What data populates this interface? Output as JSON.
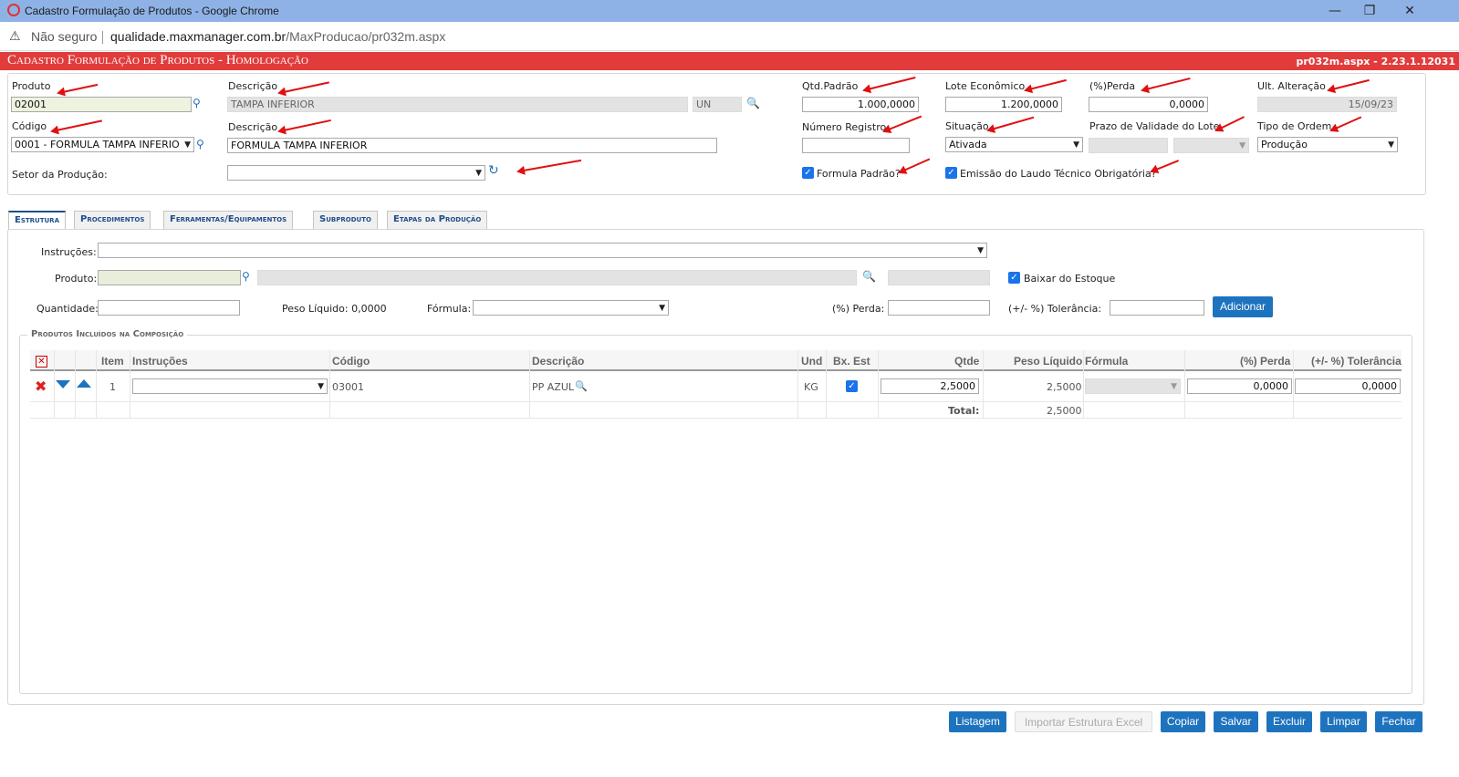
{
  "window": {
    "title": "Cadastro Formulação de Produtos - Google Chrome",
    "security": "Não seguro",
    "url_host": "qualidade.maxmanager.com.br",
    "url_path": "/MaxProducao/pr032m.aspx"
  },
  "header": {
    "title": "Cadastro Formulação de Produtos  - Homologação",
    "version": "pr032m.aspx - 2.23.1.12031",
    "color": "#e23b3b"
  },
  "form": {
    "produto_label": "Produto",
    "produto_value": "02001",
    "descricao_label": "Descrição",
    "descricao_value": "TAMPA INFERIOR",
    "unidade_value": "UN",
    "codigo_label": "Código",
    "codigo_value": "0001 - FORMULA TAMPA INFERIOR",
    "descricao2_label": "Descrição",
    "descricao2_value": "FORMULA TAMPA INFERIOR",
    "setor_label": "Setor da Produção:",
    "setor_value": "",
    "qtd_padrao_label": "Qtd.Padrão",
    "qtd_padrao_value": "1.000,0000",
    "lote_label": "Lote Econômico",
    "lote_value": "1.200,0000",
    "perda_label": "(%)Perda",
    "perda_value": "0,0000",
    "ult_alt_label": "Ult. Alteração",
    "ult_alt_value": "15/09/23",
    "num_registro_label": "Número Registro",
    "num_registro_value": "",
    "situacao_label": "Situação",
    "situacao_value": "Ativada",
    "prazo_label": "Prazo de Validade do Lote",
    "tipo_ordem_label": "Tipo de Ordem",
    "tipo_ordem_value": "Produção",
    "formula_padrao_label": "Formula Padrão?",
    "emissao_laudo_label": "Emissão do Laudo Técnico Obrigatória?"
  },
  "tabs": [
    {
      "label": "Estrutura"
    },
    {
      "label": "Procedimentos"
    },
    {
      "label": "Ferramentas/Equipamentos"
    },
    {
      "label": "Subproduto"
    },
    {
      "label": "Etapas da Produção"
    }
  ],
  "estrutura": {
    "instrucoes_label": "Instruções:",
    "produto_label": "Produto:",
    "baixar_label": "Baixar do Estoque",
    "quantidade_label": "Quantidade:",
    "peso_liquido_label": "Peso Líquido: 0,0000",
    "formula_label": "Fórmula:",
    "perda_label": "(%) Perda:",
    "tolerancia_label": "(+/- %) Tolerância:",
    "adicionar_label": "Adicionar",
    "group_title": "Produtos Incluídos na Composição"
  },
  "grid": {
    "columns": [
      "Item",
      "Instruções",
      "Código",
      "Descrição",
      "Und",
      "Bx. Est",
      "Qtde",
      "Peso Líquido",
      "Fórmula",
      "(%) Perda",
      "(+/- %) Tolerância"
    ],
    "rows": [
      {
        "item": "1",
        "instrucoes": "",
        "codigo": "03001",
        "descricao": "PP AZUL",
        "und": "KG",
        "bx_est": true,
        "qtde": "2,5000",
        "peso_liquido": "2,5000",
        "formula": "",
        "perda": "0,0000",
        "tolerancia": "0,0000"
      }
    ],
    "total_label": "Total:",
    "total_value": "2,5000"
  },
  "buttons": {
    "listagem": "Listagem",
    "importar": "Importar Estrutura Excel",
    "copiar": "Copiar",
    "salvar": "Salvar",
    "excluir": "Excluir",
    "limpar": "Limpar",
    "fechar": "Fechar"
  }
}
